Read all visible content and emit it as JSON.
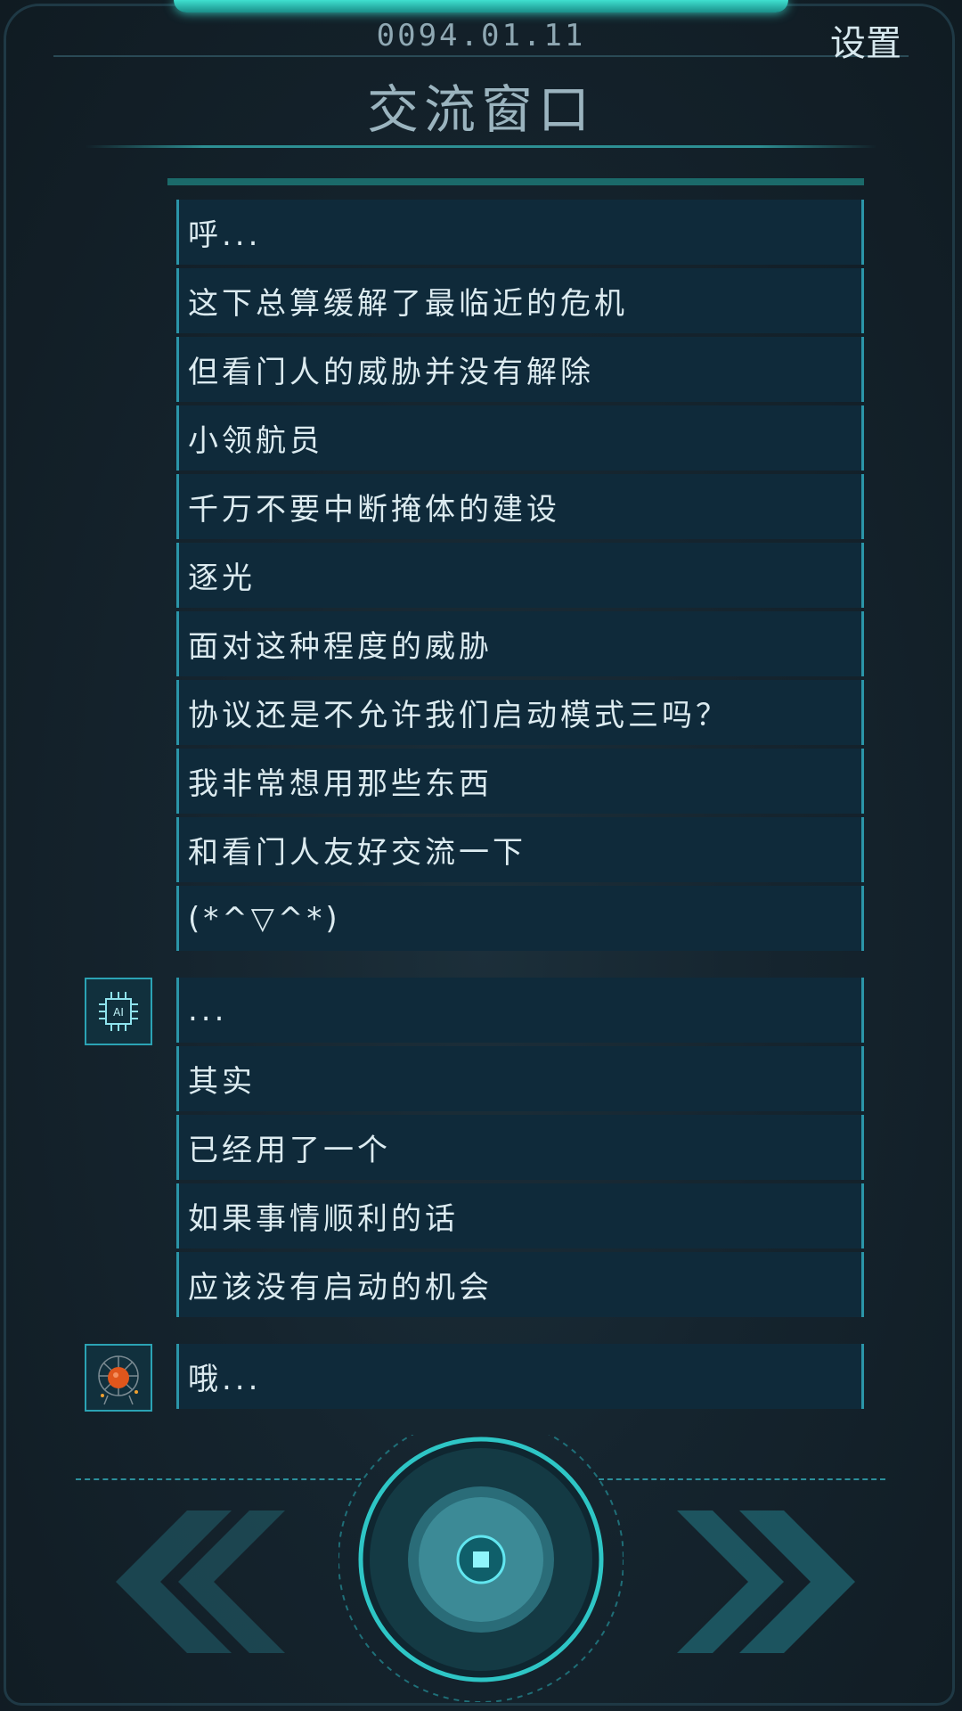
{
  "header": {
    "date": "0094.01.11",
    "settings_label": "设置",
    "title": "交流窗口"
  },
  "chat": {
    "group1": {
      "speaker": "other",
      "messages": [
        "呼...",
        "这下总算缓解了最临近的危机",
        "但看门人的威胁并没有解除",
        "小领航员",
        "千万不要中断掩体的建设",
        "逐光",
        "面对这种程度的威胁",
        "协议还是不允许我们启动模式三吗？",
        "我非常想用那些东西",
        "和看门人友好交流一下",
        "(*^▽^*)"
      ]
    },
    "group2": {
      "speaker": "AI",
      "avatar_label": "AI",
      "avatar_icon": "ai-chip-icon",
      "messages": [
        "...",
        "其实",
        "已经用了一个",
        "如果事情顺利的话",
        "应该没有启动的机会"
      ]
    },
    "group3": {
      "speaker": "player",
      "avatar_icon": "globe-network-icon",
      "messages": [
        "哦..."
      ]
    }
  },
  "controls": {
    "prev_icon": "double-chevron-left-icon",
    "next_icon": "double-chevron-right-icon",
    "center_icon": "stop-square-icon"
  },
  "colors": {
    "accent": "#2b95a8",
    "glow": "#3fe0d0",
    "bubble": "#0f2a3a",
    "background": "#13212b",
    "avatar_orange": "#e0561c"
  }
}
